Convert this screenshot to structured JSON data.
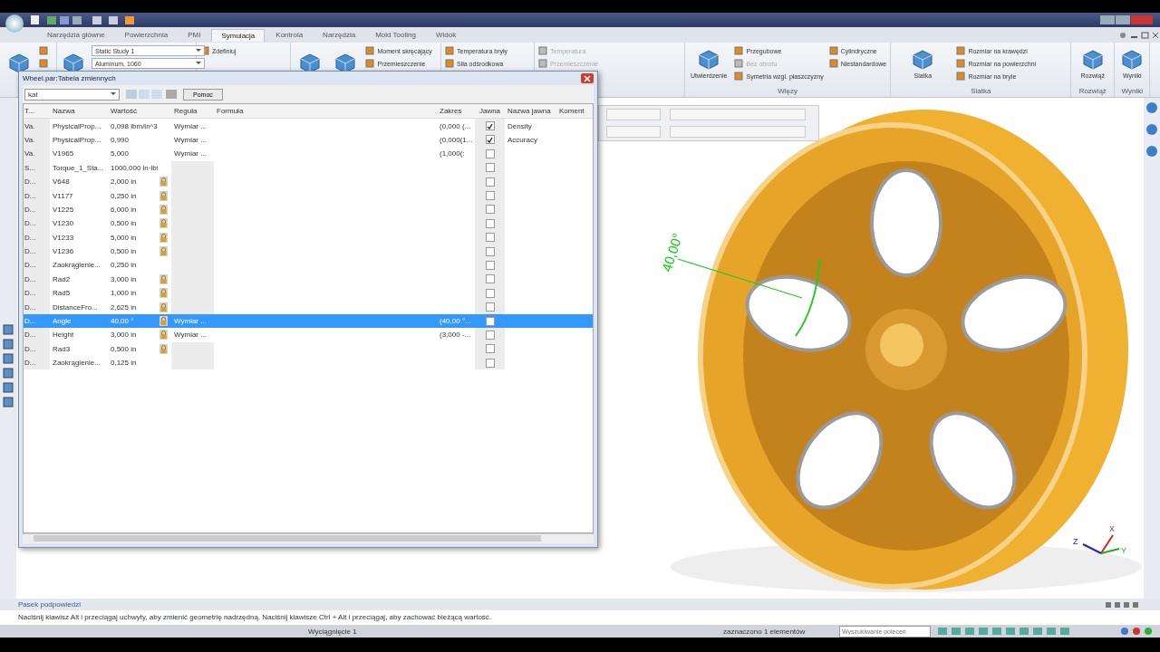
{
  "tabs": [
    {
      "label": "Narzędzia główne",
      "selected": false
    },
    {
      "label": "Powierzchnia",
      "selected": false
    },
    {
      "label": "PMI",
      "selected": false
    },
    {
      "label": "Symulacja",
      "selected": true
    },
    {
      "label": "Kontrola",
      "selected": false
    },
    {
      "label": "Narzędzia",
      "selected": false
    },
    {
      "label": "Mold Tooling",
      "selected": false
    },
    {
      "label": "Widok",
      "selected": false
    }
  ],
  "ribbon": {
    "groups": [
      {
        "items": [
          {
            "kind": "large",
            "disabled": false
          },
          {
            "kind": "small",
            "disabled": false
          },
          {
            "kind": "small",
            "disabled": false
          }
        ]
      },
      {
        "items": [
          {
            "kind": "large",
            "disabled": false
          },
          {
            "kind": "combo",
            "label": "Static Study 1",
            "disabled": false
          },
          {
            "kind": "combo",
            "label": "Aluminum, 1060",
            "disabled": false
          }
        ]
      },
      {
        "items": [
          {
            "kind": "small",
            "label": "Zdefiniuj",
            "disabled": false
          }
        ]
      },
      {
        "items": [
          {
            "kind": "large",
            "disabled": false
          },
          {
            "kind": "large",
            "disabled": false
          },
          {
            "kind": "small",
            "label": "Moment skręcający",
            "disabled": false
          },
          {
            "kind": "small",
            "label": "Przemieszczenie",
            "disabled": false
          }
        ]
      },
      {
        "items": [
          {
            "kind": "small",
            "label": "Temperatura bryły",
            "disabled": false
          },
          {
            "kind": "small",
            "label": "Siła odśrodkowa",
            "disabled": false
          }
        ]
      },
      {
        "items": [
          {
            "kind": "small",
            "label": "Temperatura",
            "disabled": true
          },
          {
            "kind": "small",
            "label": "Przemieszczenie",
            "disabled": true
          }
        ]
      },
      {
        "label": "Więzy",
        "items": [
          {
            "kind": "large",
            "label": "Utwierdzenie",
            "disabled": false
          },
          {
            "kind": "small",
            "label": "Przegubowe",
            "disabled": false
          },
          {
            "kind": "small",
            "label": "Bez obrotu",
            "disabled": true
          },
          {
            "kind": "small",
            "label": "Symetria wzgl. płaszczyzny",
            "disabled": false
          },
          {
            "kind": "small",
            "label": "Cylindryczne",
            "disabled": false
          },
          {
            "kind": "small",
            "label": "Niestandardowe",
            "disabled": false
          }
        ]
      },
      {
        "label": "Siatka",
        "items": [
          {
            "kind": "large",
            "label": "Siatka",
            "disabled": false
          },
          {
            "kind": "small",
            "label": "Rozmiar na krawędzi",
            "disabled": false
          },
          {
            "kind": "small",
            "label": "Rozmiar na powierzchni",
            "disabled": false
          },
          {
            "kind": "small",
            "label": "Rozmiar na bryle",
            "disabled": false
          }
        ]
      },
      {
        "label": "Rozwiąż",
        "items": [
          {
            "kind": "large",
            "label": "Rozwiąż",
            "disabled": false
          }
        ]
      },
      {
        "label": "Wyniki",
        "items": [
          {
            "kind": "large",
            "label": "Wyniki",
            "disabled": false
          }
        ]
      }
    ]
  },
  "dialog": {
    "title": "Wheel.par:Tabela zmiennych",
    "filter": "kat",
    "help_button": "Pomoc",
    "columns": [
      "T...",
      "Nazwa",
      "Wartość",
      "Reguła",
      "Formuła",
      "Zakres",
      "Jawna",
      "Nazwa jawna",
      "Koment"
    ],
    "rows": [
      {
        "type": "Va.",
        "name": "PhysicalProp...",
        "value": "0,098 lbm/in^3",
        "locked": false,
        "rule": "Wymiar ...",
        "range": "(0,000 (...",
        "explicit": true,
        "explicit_name": "Density",
        "selected": false
      },
      {
        "type": "Va.",
        "name": "PhysicalProp...",
        "value": "0,990",
        "locked": false,
        "rule": "Wymiar ...",
        "range": "(0,000(1...",
        "explicit": true,
        "explicit_name": "Accuracy",
        "selected": false
      },
      {
        "type": "Va.",
        "name": "V1965",
        "value": "5,000",
        "locked": false,
        "rule": "Wymiar ...",
        "range": "(1,000(:",
        "explicit": false,
        "selected": false
      },
      {
        "type": "S...",
        "name": "Torque_1_Sta...",
        "value": "1000,000 in·lbf",
        "locked": false,
        "explicit": false,
        "selected": false
      },
      {
        "type": "D...",
        "name": "V648",
        "value": "2,000 in",
        "locked": true,
        "explicit": false,
        "selected": false
      },
      {
        "type": "D...",
        "name": "V1177",
        "value": "0,250 in",
        "locked": true,
        "explicit": false,
        "selected": false
      },
      {
        "type": "D...",
        "name": "V1225",
        "value": "6,000 in",
        "locked": true,
        "explicit": false,
        "selected": false
      },
      {
        "type": "D...",
        "name": "V1230",
        "value": "0,500 in",
        "locked": true,
        "explicit": false,
        "selected": false
      },
      {
        "type": "D...",
        "name": "V1233",
        "value": "5,000 in",
        "locked": true,
        "explicit": false,
        "selected": false
      },
      {
        "type": "D...",
        "name": "V1236",
        "value": "0,500 in",
        "locked": true,
        "explicit": false,
        "selected": false
      },
      {
        "type": "D...",
        "name": "Zaokrąglenie...",
        "value": "0,250 in",
        "locked": false,
        "explicit": false,
        "selected": false
      },
      {
        "type": "D...",
        "name": "Rad2",
        "value": "3,000 in",
        "locked": true,
        "explicit": false,
        "selected": false
      },
      {
        "type": "D...",
        "name": "Rad5",
        "value": "1,000 in",
        "locked": true,
        "explicit": false,
        "selected": false
      },
      {
        "type": "D...",
        "name": "DistanceFro...",
        "value": "2,625 in",
        "locked": true,
        "explicit": false,
        "selected": false
      },
      {
        "type": "D...",
        "name": "Angle",
        "value": "40,00 °",
        "locked": true,
        "rule": "Wymiar ...",
        "range": "(40,00 °...",
        "explicit": false,
        "selected": true
      },
      {
        "type": "D...",
        "name": "Height",
        "value": "3,000 in",
        "locked": true,
        "rule": "Wymiar ...",
        "range": "(3,000 -...",
        "explicit": false,
        "selected": false
      },
      {
        "type": "D...",
        "name": "Rad3",
        "value": "0,500 in",
        "locked": true,
        "explicit": false,
        "selected": false
      },
      {
        "type": "D...",
        "name": "Zaokrąglenie...",
        "value": "0,125 in",
        "locked": false,
        "explicit": false,
        "selected": false
      }
    ]
  },
  "viewport": {
    "dimension": "40,00°",
    "axes": [
      "X",
      "Y",
      "Z"
    ]
  },
  "hint_panel": {
    "title": "Pasek podpowiedzi",
    "text": "Naciśnij klawisz Alt i przeciągaj uchwyty, aby zmienić geometrię nadrzędną. Naciśnij klawisze Ctrl + Alt i przeciągaj, aby zachować bieżącą wartość."
  },
  "status_bar": {
    "feature": "Wyciągnięcie 1",
    "selection": "zaznaczono 1 elementów",
    "search": {
      "placeholder": "Wyszukiwanie poleceń"
    }
  }
}
